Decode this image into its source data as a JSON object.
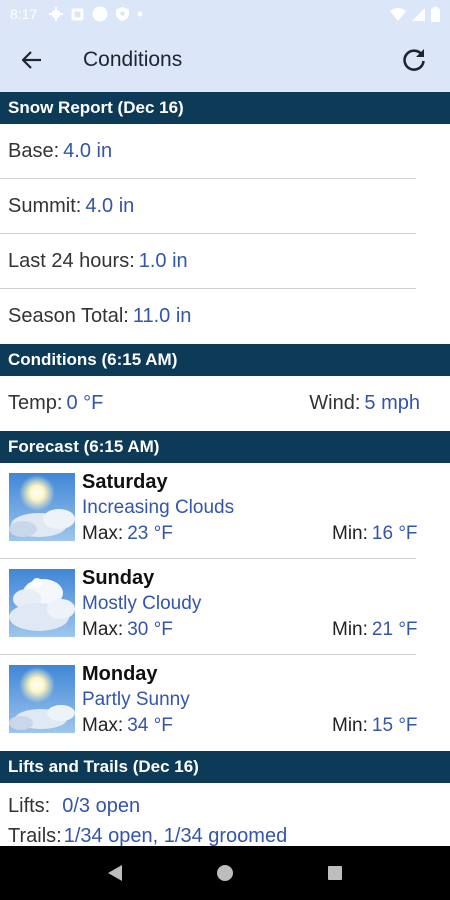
{
  "status_bar": {
    "time": "8:17"
  },
  "app_bar": {
    "title": "Conditions"
  },
  "snow_report": {
    "header": "Snow Report (Dec 16)",
    "rows": [
      {
        "label": "Base:",
        "value": "4.0 in"
      },
      {
        "label": "Summit:",
        "value": "4.0 in"
      },
      {
        "label": "Last 24 hours:",
        "value": "1.0 in"
      },
      {
        "label": "Season Total:",
        "value": "11.0 in"
      }
    ]
  },
  "conditions": {
    "header": "Conditions (6:15 AM)",
    "temp_label": "Temp:",
    "temp_value": "0 °F",
    "wind_label": "Wind:",
    "wind_value": "5 mph"
  },
  "forecast": {
    "header": "Forecast (6:15 AM)",
    "max_label": "Max:",
    "min_label": "Min:",
    "days": [
      {
        "day": "Saturday",
        "desc": "Increasing Clouds",
        "max": "23 °F",
        "min": "16 °F",
        "icon": "partly-cloudy-icon"
      },
      {
        "day": "Sunday",
        "desc": "Mostly Cloudy",
        "max": "30 °F",
        "min": "21 °F",
        "icon": "mostly-cloudy-icon"
      },
      {
        "day": "Monday",
        "desc": "Partly Sunny",
        "max": "34 °F",
        "min": "15 °F",
        "icon": "partly-sunny-icon"
      }
    ]
  },
  "lifts_trails": {
    "header": "Lifts and Trails (Dec 16)",
    "lifts_label": "Lifts:",
    "lifts_value": "0/3 open",
    "trails_label": "Trails:",
    "trails_value": "1/34 open, 1/34 groomed"
  },
  "colors": {
    "header_bg": "#0d3a57",
    "app_bar_bg": "#dbe6f8",
    "value_text": "#3355aa"
  }
}
